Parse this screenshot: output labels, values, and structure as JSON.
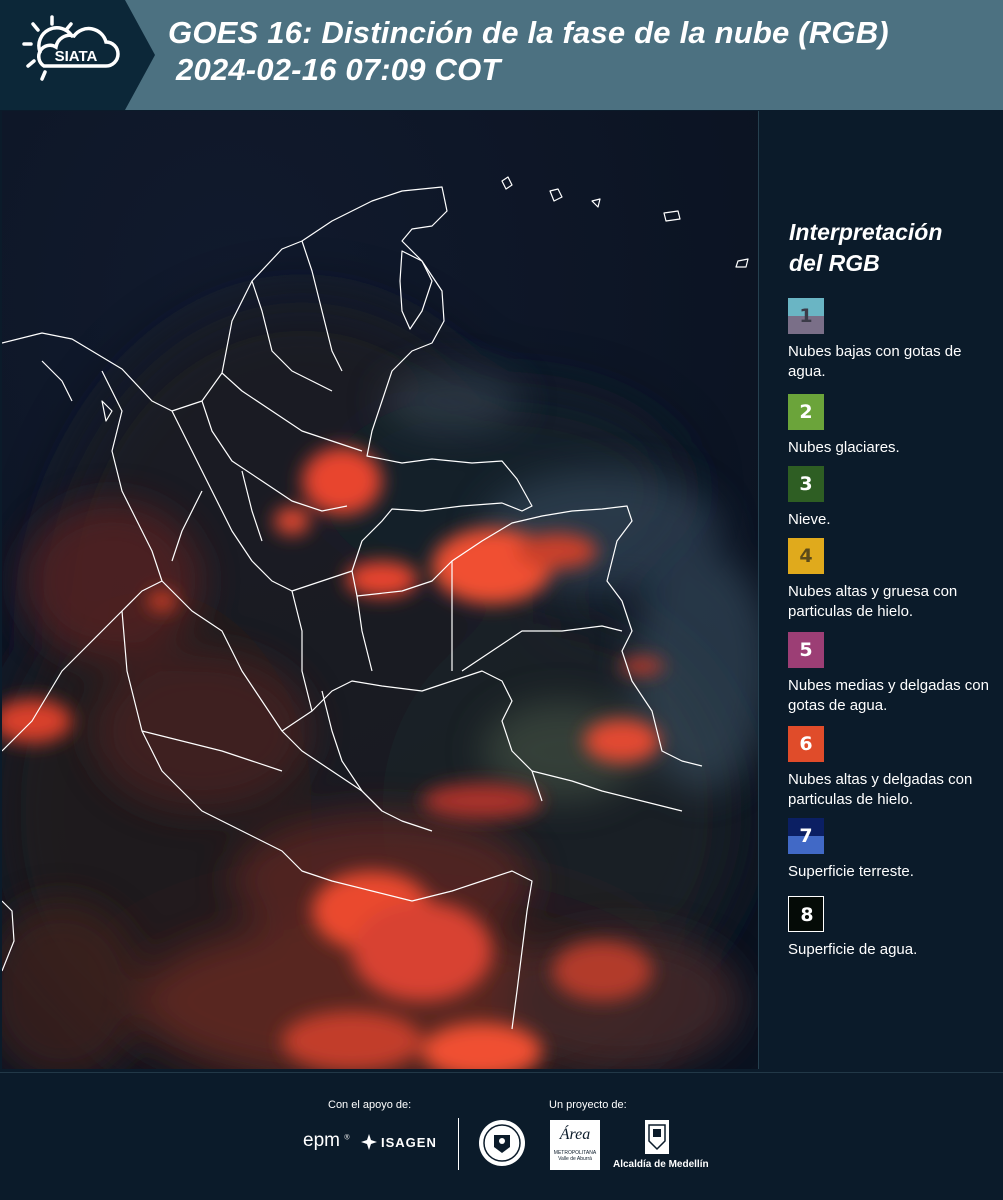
{
  "header": {
    "logo_text": "SIATA",
    "title_line1": "GOES 16: Distinción de la fase de la nube (RGB)",
    "title_line2": "2024-02-16 07:09 COT"
  },
  "legend": {
    "title_line1": "Interpretación",
    "title_line2": "del RGB",
    "items": [
      {
        "num": "1",
        "label": "Nubes bajas con gotas de agua.",
        "colors": [
          "#6ab5c4",
          "#7a6f88"
        ],
        "num_color": "#3b3b48"
      },
      {
        "num": "2",
        "label": "Nubes glaciares.",
        "colors": [
          "#6ba43a"
        ],
        "num_color": "#ffffff"
      },
      {
        "num": "3",
        "label": "Nieve.",
        "colors": [
          "#2e5e23"
        ],
        "num_color": "#ffffff"
      },
      {
        "num": "4",
        "label": "Nubes altas y gruesa con particulas de hielo.",
        "colors": [
          "#e0aa1c"
        ],
        "num_color": "#5b4a1a"
      },
      {
        "num": "5",
        "label": "Nubes medias y delgadas con gotas de agua.",
        "colors": [
          "#9c3e75"
        ],
        "num_color": "#ffffff"
      },
      {
        "num": "6",
        "label": "Nubes altas y delgadas con particulas de hielo.",
        "colors": [
          "#e04c2a"
        ],
        "num_color": "#ffffff"
      },
      {
        "num": "7",
        "label": "Superficie terreste.",
        "colors": [
          "#0b1f63",
          "#4169c6"
        ],
        "num_color": "#ffffff"
      },
      {
        "num": "8",
        "label": "Superficie de agua.",
        "colors": [
          "#050b07"
        ],
        "num_color": "#ffffff"
      }
    ]
  },
  "footer": {
    "support_label": "Con el apoyo de:",
    "project_label": "Un proyecto de:",
    "epm_logo": "epm",
    "isagen_logo": "ISAGEN",
    "metro_logo_main": "Área",
    "metro_logo_sub1": "METROPOLITANA",
    "metro_logo_sub2": "Valle de Aburrá",
    "alcaldia_label": "Alcaldía de Medellín"
  },
  "icons": {
    "siata": "siata-sun-cloud-icon",
    "isagen": "isagen-star-icon",
    "seal": "medellin-seal-icon",
    "coat": "coat-of-arms-icon"
  }
}
